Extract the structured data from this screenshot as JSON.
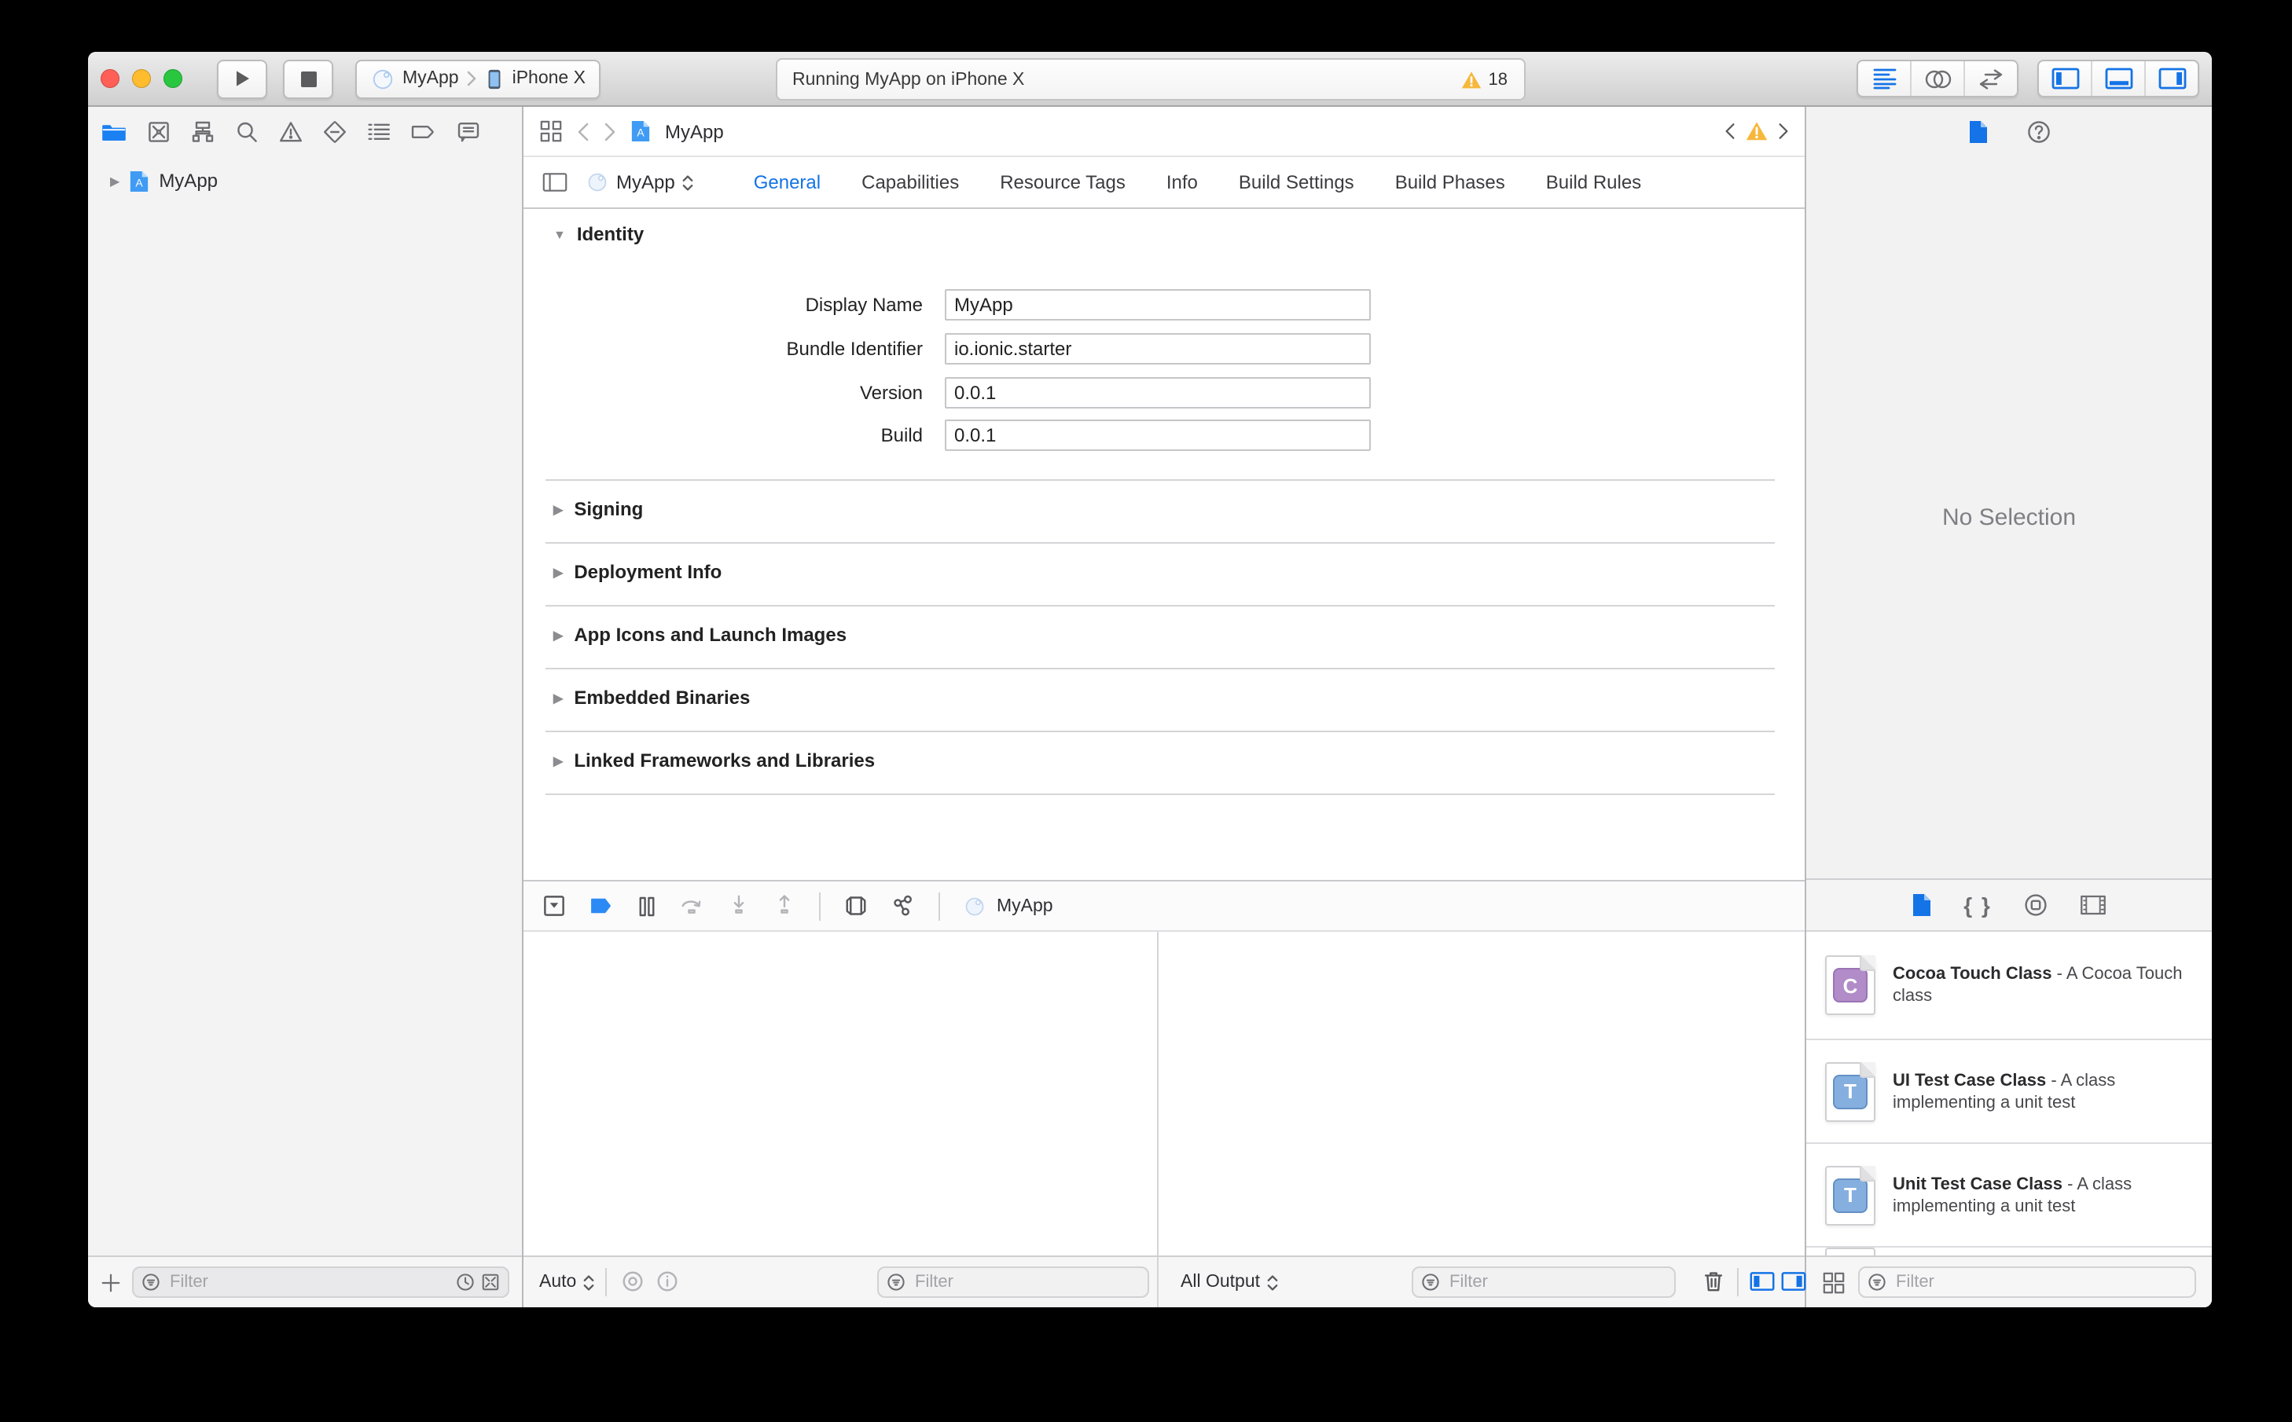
{
  "toolbar": {
    "scheme_name": "MyApp",
    "destination": "iPhone X",
    "status_text": "Running MyApp on iPhone X",
    "warning_count": "18"
  },
  "sidebar": {
    "project": "MyApp",
    "filter_placeholder": "Filter"
  },
  "editor": {
    "jump_file": "MyApp",
    "target": "MyApp",
    "tabs": [
      "General",
      "Capabilities",
      "Resource Tags",
      "Info",
      "Build Settings",
      "Build Phases",
      "Build Rules"
    ],
    "identity": {
      "title": "Identity",
      "fields": [
        {
          "label": "Display Name",
          "value": "MyApp"
        },
        {
          "label": "Bundle Identifier",
          "value": "io.ionic.starter"
        },
        {
          "label": "Version",
          "value": "0.0.1"
        },
        {
          "label": "Build",
          "value": "0.0.1"
        }
      ]
    },
    "sections": [
      "Signing",
      "Deployment Info",
      "App Icons and Launch Images",
      "Embedded Binaries",
      "Linked Frameworks and Libraries"
    ]
  },
  "debug": {
    "breadcrumb": "MyApp",
    "auto_label": "Auto",
    "output_label": "All Output",
    "variables_filter_placeholder": "Filter",
    "console_filter_placeholder": "Filter"
  },
  "inspector": {
    "empty_text": "No Selection"
  },
  "library": {
    "filter_placeholder": "Filter",
    "items": [
      {
        "badge": "C",
        "name": "Cocoa Touch Class",
        "desc": "- A Cocoa Touch class"
      },
      {
        "badge": "T",
        "name": "UI Test Case Class",
        "desc": "- A class implementing a unit test"
      },
      {
        "badge": "T",
        "name": "Unit Test Case Class",
        "desc": "- A class implementing a unit test"
      }
    ]
  },
  "colors": {
    "accent": "#1473e6",
    "warning": "#f6b73c"
  }
}
